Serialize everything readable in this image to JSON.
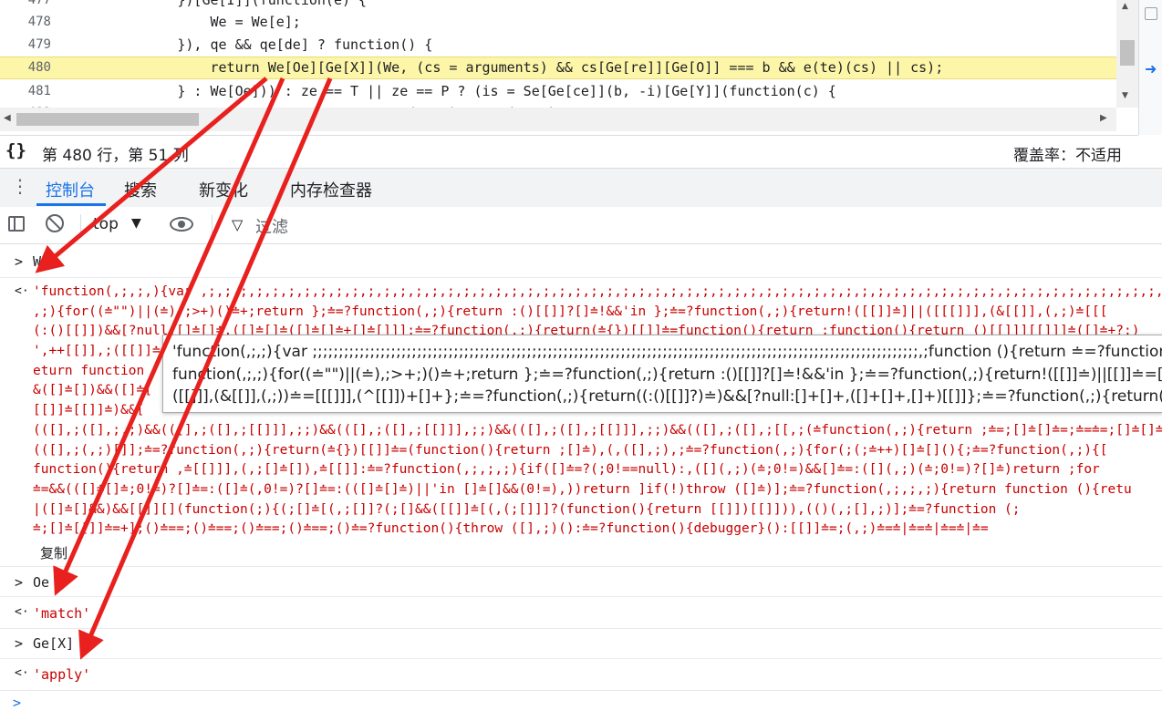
{
  "editor": {
    "lines": [
      {
        "num": "477",
        "code": "            })[Ge[I]](function(e) {",
        "highlight": false
      },
      {
        "num": "478",
        "code": "                We = We[e];",
        "highlight": false
      },
      {
        "num": "479",
        "code": "            }), qe && qe[de] ? function() {",
        "highlight": false
      },
      {
        "num": "480",
        "code": "                return We[Oe][Ge[X]](We, (cs = arguments) && cs[Ge[re]][Ge[O]] === b && e(te)(cs) || cs);",
        "highlight": true
      },
      {
        "num": "481",
        "code": "            } : We[Oe])) : ze == T || ze == P ? (is = Se[Ge[ce]](b, -i)[Ge[Y]](function(c) {",
        "highlight": false
      },
      {
        "num": "482",
        "code": "                                        (    )      (    )",
        "highlight": false
      }
    ]
  },
  "statusbar": {
    "braces": "{}",
    "position": "第 480 行，第 51 列",
    "coverage": "覆盖率：不适用"
  },
  "drawer": {
    "tabs": [
      "控制台",
      "搜索",
      "新变化",
      "内存检查器"
    ],
    "active_tab": "控制台"
  },
  "toolbar": {
    "context": "top",
    "filter_label": "过滤"
  },
  "console": {
    "input_glyph": ">",
    "output_glyph": "<·",
    "entries": [
      {
        "type": "input",
        "text": "We"
      },
      {
        "type": "output-block",
        "lines": [
          "'function(,;,;,){var ,;,;,;,;,;,;,;,;,;,;,;,;,;,;,;,;,;,;,;,;,;,;,;,;,;,;,;,;,;,;,;,;,;,;,;,;,;,;,;,;,;,;,;,;,;,;,;,;,;,;,;,;,;,;,;,;,;,;,;,;,;,;,",
          ",;){for((≐\"\")||(≐),;>+)()≐+;return };≐=?function(,;){return :()[[]]?[]≐!&&'in };≐=?function(,;){return!([[]]≐]||([[[]]],(&[[]],(,;)≐[[[",
          "(:()[[]])&&[?null:[]≐[]≐,([]≐[]≐([]≐[]≐+[]≐[]]];≐=?function(,;){return(≐{})[[]]≐=function(){return ;function(){return ()[[]]][[]]]≐([]≐+?:)",
          "',++[[]],;([[]]≐(",
          "eturn function",
          "&([]≐[])&&([]≐[",
          "[[]]≐[[]]≐)&&[",
          "(([],;([],;,;)&&(([],;([],;[[]]],;;)&&(([],;([],;[[]]],;;)&&(([],;([],;[[]]],;;)&&(([],;([],;[[,;(≐function(,;){return ;≐=;[]≐[]≐=;≐=≐=;[]≐[]≐=;(|;(",
          "(([],;(,;)[]];≐=?function(,;){return(≐{})[[]]≐=(function(){return ;[]≐),(,([],;),;≐=?function(,;){for(;(;≐++)[]≐[](){;≐=?function(,;){[",
          "function(){return ,≐[[]]],(,;[]≐[]),≐[[]]:≐=?function(,;,;,;){if([]≐=?(;0!==null):,([](,;)(≐;0!=)&&[]≐=:([](,;)(≐;0!=)?[]≐)return ;for",
          "≐=&&(([]≐[]≐;0!=)?[]≐=:([]≐(,0!=)?[]≐=:(([]≐[]≐)||'in []≐[]&&(0!=),))return ]if(!)throw ([]≐)];≐=?function(,;,;,;){return function (){retu",
          "|([]≐[]&&)&&[[]][](function(;){(;[]≐[(,;[]]?(;[]&&([[]]≐[(,(;[]]]?(function(){return [[]])[[]])),(()(,;[],;)];≐=?function (;",
          "≐;[]≐[[]]≐=+];()≐==;()≐==;()≐==;()≐==;()≐=?function(){throw ([],;)():≐=?function(){debugger}():[[]]≐=;(,;)≐=≐|≐=≐|≐=≐|≐="
        ],
        "copy_label": "复制"
      },
      {
        "type": "input",
        "text": "Oe"
      },
      {
        "type": "output",
        "text": "'match'"
      },
      {
        "type": "input",
        "text": "Ge[X]"
      },
      {
        "type": "output",
        "text": "'apply'"
      }
    ],
    "prompt_glyph": ">"
  },
  "tooltip": {
    "lines": [
      "'function(,;,;){var ;;;;;;;;;;;;;;;;;;;;;;;;;;;;;;;;;;;;;;;;;;;;;;;;;;;;;;;;;;;;;;;;;;;;;;;;;;;;;;;;;;;;;;;;;;;;;;;;;;;;;;;;;;;;;;;;;;;;,;function (){return ≐=?function(){return [[]]",
      "function(,;,;){for((≐\"\")||(≐),;>+;)()≐+;return };≐=?function(,;){return :()[[]]?[]≐!&&'in };≐=?function(,;){return!([[]]≐)||[[]]≐=[[]]:[[]]]?|",
      "([[]]],(&[[]],(,;))≐=[[[]]],(^[[]])+[]+};≐=?function(,;){return((:()[[]]?)≐)&&[?null:[]+[]+,([]+[]+,[]+)[[]]};≐=?function(,;){return(≐{})[..."
    ]
  },
  "colors": {
    "accent": "#1a73e8",
    "highlight_line": "#fdf6a8",
    "string_red": "#c80000",
    "annotation_arrow": "#e8201e"
  }
}
